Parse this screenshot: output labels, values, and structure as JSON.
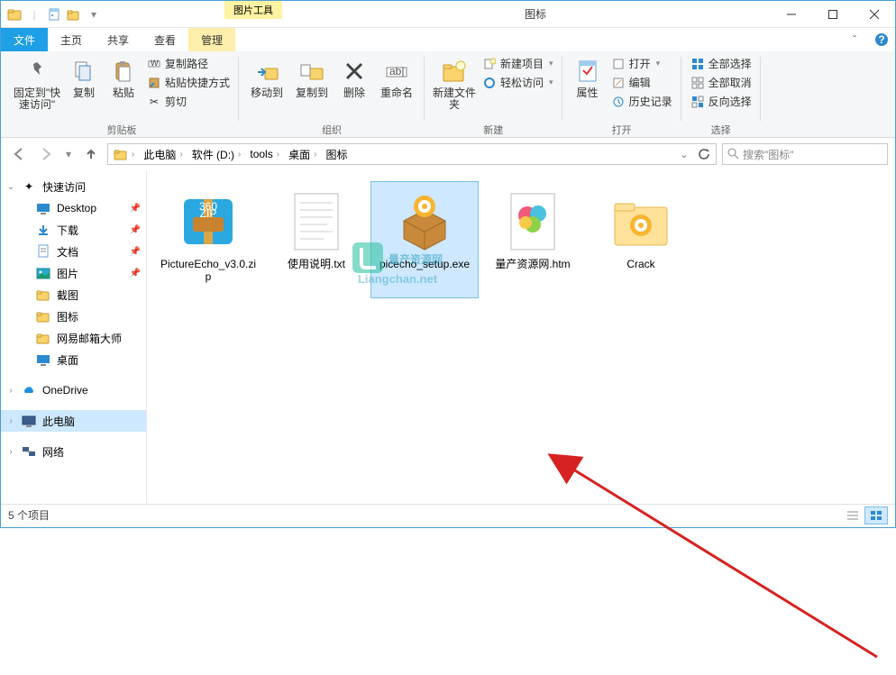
{
  "window": {
    "title": "图标",
    "contextual_tab_title": "图片工具"
  },
  "tabs": {
    "file": "文件",
    "home": "主页",
    "share": "共享",
    "view": "查看",
    "manage": "管理"
  },
  "ribbon": {
    "pin": {
      "label": "固定到\"快速访问\""
    },
    "copy": {
      "label": "复制"
    },
    "paste": {
      "label": "粘贴"
    },
    "copy_path": "复制路径",
    "paste_shortcut": "粘贴快捷方式",
    "cut": "剪切",
    "group_clipboard": "剪贴板",
    "move_to": "移动到",
    "copy_to": "复制到",
    "delete": "删除",
    "rename": "重命名",
    "group_organize": "组织",
    "new_folder": "新建文件夹",
    "new_item": "新建项目",
    "easy_access": "轻松访问",
    "group_new": "新建",
    "properties": "属性",
    "open": "打开",
    "edit": "编辑",
    "history": "历史记录",
    "group_open": "打开",
    "select_all": "全部选择",
    "select_none": "全部取消",
    "invert_selection": "反向选择",
    "group_select": "选择"
  },
  "breadcrumb": [
    "此电脑",
    "软件 (D:)",
    "tools",
    "桌面",
    "图标"
  ],
  "search": {
    "placeholder": "搜索\"图标\""
  },
  "sidebar": {
    "quick_access": "快速访问",
    "children": [
      {
        "key": "desktop",
        "label": "Desktop",
        "pinned": true
      },
      {
        "key": "downloads",
        "label": "下载",
        "pinned": true
      },
      {
        "key": "documents",
        "label": "文档",
        "pinned": true
      },
      {
        "key": "pictures",
        "label": "图片",
        "pinned": true
      },
      {
        "key": "screenshots",
        "label": "截图",
        "pinned": false
      },
      {
        "key": "icons",
        "label": "图标",
        "pinned": false
      },
      {
        "key": "netease",
        "label": "网易邮箱大师",
        "pinned": false
      },
      {
        "key": "desktop2",
        "label": "桌面",
        "pinned": false
      }
    ],
    "onedrive": "OneDrive",
    "this_pc": "此电脑",
    "network": "网络"
  },
  "files": [
    {
      "name": "PictureEcho_v3.0.zip",
      "type": "zip",
      "selected": false
    },
    {
      "name": "使用说明.txt",
      "type": "txt",
      "selected": false
    },
    {
      "name": "picecho_setup.exe",
      "type": "exe",
      "selected": true
    },
    {
      "name": "量产资源网.htm",
      "type": "htm",
      "selected": false
    },
    {
      "name": "Crack",
      "type": "folder",
      "selected": false
    }
  ],
  "status": {
    "count_label": "5 个项目"
  },
  "watermark": {
    "main": "量产资源网",
    "sub": "Liangchan.net"
  }
}
